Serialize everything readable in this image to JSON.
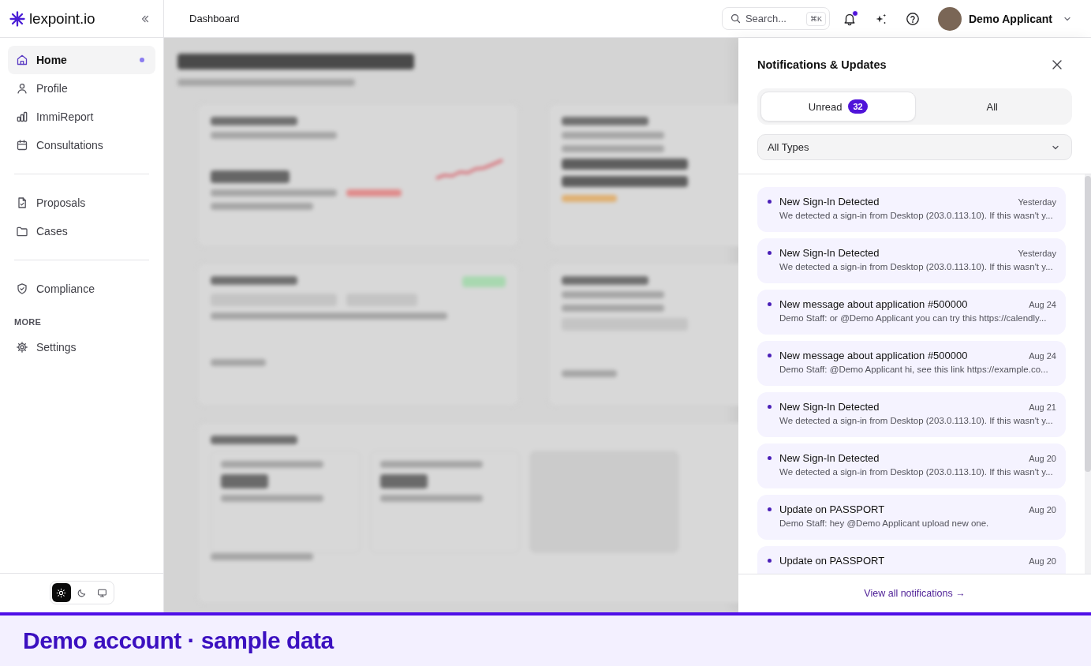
{
  "sidebar": {
    "logo": "lexpoint.io",
    "sections": [
      {
        "items": [
          {
            "kind": "link",
            "label": "Home",
            "selected": true,
            "dot": true
          },
          {
            "kind": "link",
            "label": "Profile",
            "selected": false,
            "dot": false
          },
          {
            "kind": "link",
            "label": "ImmiReport",
            "selected": false,
            "dot": false
          },
          {
            "kind": "link",
            "label": "Consultations",
            "selected": false,
            "dot": false
          }
        ]
      },
      {
        "items": [
          {
            "kind": "link",
            "label": "Proposals",
            "selected": false,
            "dot": false
          },
          {
            "kind": "link",
            "label": "Cases",
            "selected": false,
            "dot": false
          }
        ]
      },
      {
        "items": [
          {
            "kind": "link",
            "label": "Compliance",
            "selected": false,
            "dot": false
          },
          {
            "kind": "heading",
            "label": "MORE"
          },
          {
            "kind": "link",
            "label": "Settings",
            "selected": false,
            "dot": false
          }
        ]
      }
    ],
    "theme_options": [
      {
        "selected": true
      },
      {
        "selected": false
      },
      {
        "selected": false
      }
    ]
  },
  "header": {
    "breadcrumb": "Dashboard",
    "search": {
      "placeholder": "Search...",
      "shortcut": "⌘K"
    },
    "notifications_unread": true,
    "user": {
      "name": "Demo Applicant"
    }
  },
  "notifications": {
    "title": "Notifications & Updates",
    "tabs": [
      {
        "label": "Unread",
        "count": "32",
        "selected": true
      },
      {
        "label": "All",
        "selected": false
      }
    ],
    "filter": {
      "value": "All Types"
    },
    "items": [
      {
        "title": "New Sign-In Detected",
        "date": "Yesterday",
        "body": "We detected a sign-in from Desktop (203.0.113.10). If this wasn't y...",
        "unread": true
      },
      {
        "title": "New Sign-In Detected",
        "date": "Yesterday",
        "body": "We detected a sign-in from Desktop (203.0.113.10). If this wasn't y...",
        "unread": true
      },
      {
        "title": "New message about application #500000",
        "date": "Aug 24",
        "body": "Demo Staff: or @Demo Applicant you can try this https://calendly...",
        "unread": true
      },
      {
        "title": "New message about application #500000",
        "date": "Aug 24",
        "body": "Demo Staff: @Demo Applicant hi, see this link https://example.co...",
        "unread": true
      },
      {
        "title": "New Sign-In Detected",
        "date": "Aug 21",
        "body": "We detected a sign-in from Desktop (203.0.113.10). If this wasn't y...",
        "unread": true
      },
      {
        "title": "New Sign-In Detected",
        "date": "Aug 20",
        "body": "We detected a sign-in from Desktop (203.0.113.10). If this wasn't y...",
        "unread": true
      },
      {
        "title": "Update on PASSPORT",
        "date": "Aug 20",
        "body": "Demo Staff: hey @Demo Applicant upload new one.",
        "unread": true
      },
      {
        "title": "Update on PASSPORT",
        "date": "Aug 20",
        "unread": true
      }
    ],
    "footer_link": "View all notifications →"
  },
  "banner": {
    "text": "Demo account · sample data"
  }
}
